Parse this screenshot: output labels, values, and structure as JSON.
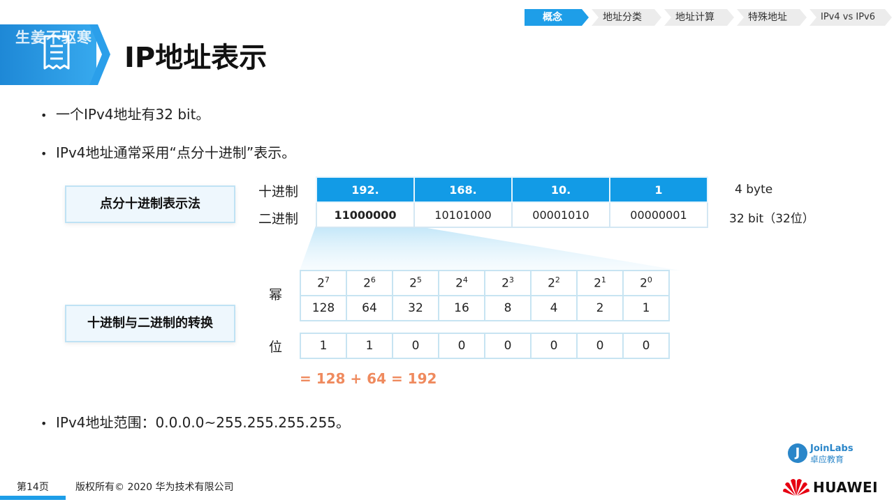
{
  "nav": {
    "items": [
      {
        "label": "概念",
        "active": true
      },
      {
        "label": "地址分类",
        "active": false
      },
      {
        "label": "地址计算",
        "active": false
      },
      {
        "label": "特殊地址",
        "active": false
      },
      {
        "label": "IPv4 vs IPv6",
        "active": false
      }
    ]
  },
  "header": {
    "watermark": "生姜不驱寒",
    "title": "IP地址表示",
    "icon": "document-list-icon"
  },
  "bullets": [
    "一个IPv4地址有32 bit。",
    "IPv4地址通常采用“点分十进制”表示。",
    "IPv4地址范围：0.0.0.0~255.255.255.255。"
  ],
  "dotted_decimal": {
    "label": "点分十进制表示法",
    "row_labels": [
      "十进制",
      "二进制"
    ],
    "decimal": [
      "192.",
      "168.",
      "10.",
      "1"
    ],
    "binary": [
      "11000000",
      "10101000",
      "00001010",
      "00000001"
    ],
    "notes": [
      "4 byte",
      "32 bit（32位）"
    ]
  },
  "conversion": {
    "label": "十进制与二进制的转换",
    "row_labels": [
      "幂",
      "位"
    ],
    "powers": [
      "7",
      "6",
      "5",
      "4",
      "3",
      "2",
      "1",
      "0"
    ],
    "base": "2",
    "values": [
      "128",
      "64",
      "32",
      "16",
      "8",
      "4",
      "2",
      "1"
    ],
    "bits": [
      "1",
      "1",
      "0",
      "0",
      "0",
      "0",
      "0",
      "0"
    ],
    "formula": "= 128 + 64 = 192"
  },
  "footer": {
    "page": "第14页",
    "copyright": "版权所有© 2020 华为技术有限公司"
  },
  "logos": {
    "joinlabs_mark": "J",
    "joinlabs_name": "JoinLabs",
    "joinlabs_cn": "卓应教育",
    "huawei_name": "HUAWEI"
  },
  "colors": {
    "accent": "#129be6",
    "formula": "#ef8a5e",
    "huawei_red": "#e60012"
  }
}
